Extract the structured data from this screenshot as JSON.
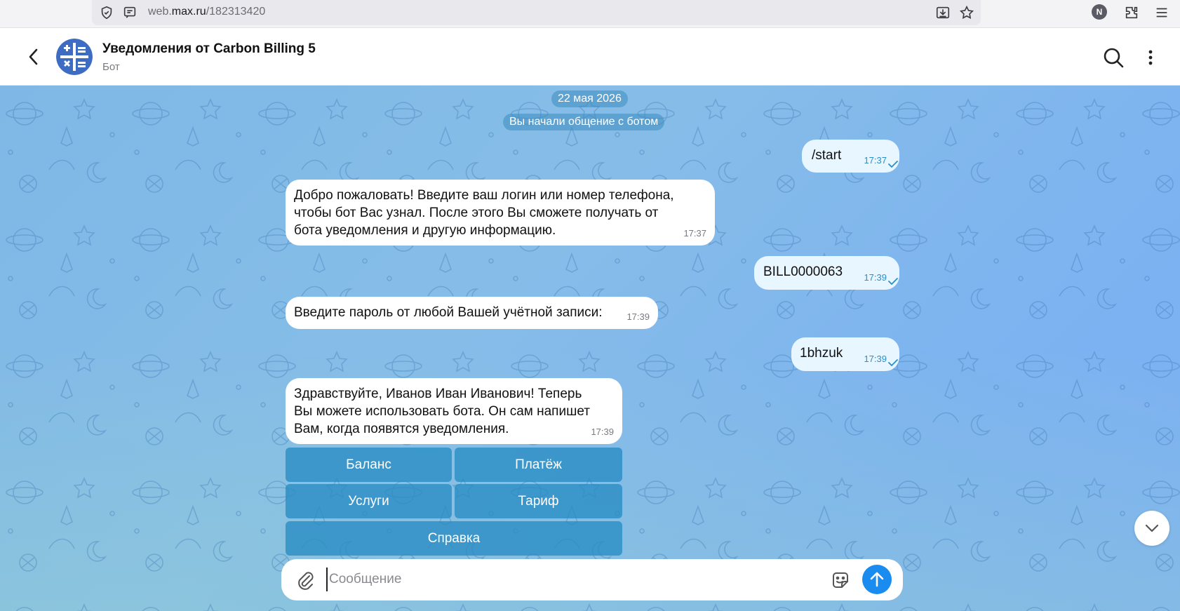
{
  "browser": {
    "url_prefix": "web.",
    "url_domain": "max.ru",
    "url_path": "/182313420",
    "profile_initial": "N"
  },
  "header": {
    "title": "Уведомления от Carbon Billing 5",
    "subtitle": "Бот"
  },
  "chat": {
    "date": "22 мая 2026",
    "system_message": "Вы начали общение с ботом",
    "messages": [
      {
        "direction": "out",
        "lines": [
          "/start"
        ],
        "time": "17:37"
      },
      {
        "direction": "in",
        "lines": [
          "Добро пожаловать! Введите ваш логин или номер телефона,",
          "чтобы бот Вас узнал. После этого Вы сможете получать от",
          "бота уведомления и другую информацию."
        ],
        "time": "17:37"
      },
      {
        "direction": "out",
        "lines": [
          "BILL0000063"
        ],
        "time": "17:39"
      },
      {
        "direction": "in",
        "lines": [
          "Введите пароль от любой Вашей учётной записи:"
        ],
        "time": "17:39"
      },
      {
        "direction": "out",
        "lines": [
          "1bhzuk"
        ],
        "time": "17:39"
      },
      {
        "direction": "in",
        "lines": [
          "Здравствуйте, Иванов Иван Иванович! Теперь",
          "Вы можете использовать бота. Он сам напишет",
          "Вам, когда появятся уведомления."
        ],
        "time": "17:39"
      }
    ],
    "keyboard": {
      "balance": "Баланс",
      "payment": "Платёж",
      "services": "Услуги",
      "tariff": "Тариф",
      "help": "Справка"
    }
  },
  "composer": {
    "placeholder": "Сообщение"
  },
  "colors": {
    "accent": "#1a8cf0",
    "keyboard_button": "#2f92c8",
    "outgoing_bubble": "#e8f6ff",
    "outgoing_time": "#2a8fc6"
  }
}
